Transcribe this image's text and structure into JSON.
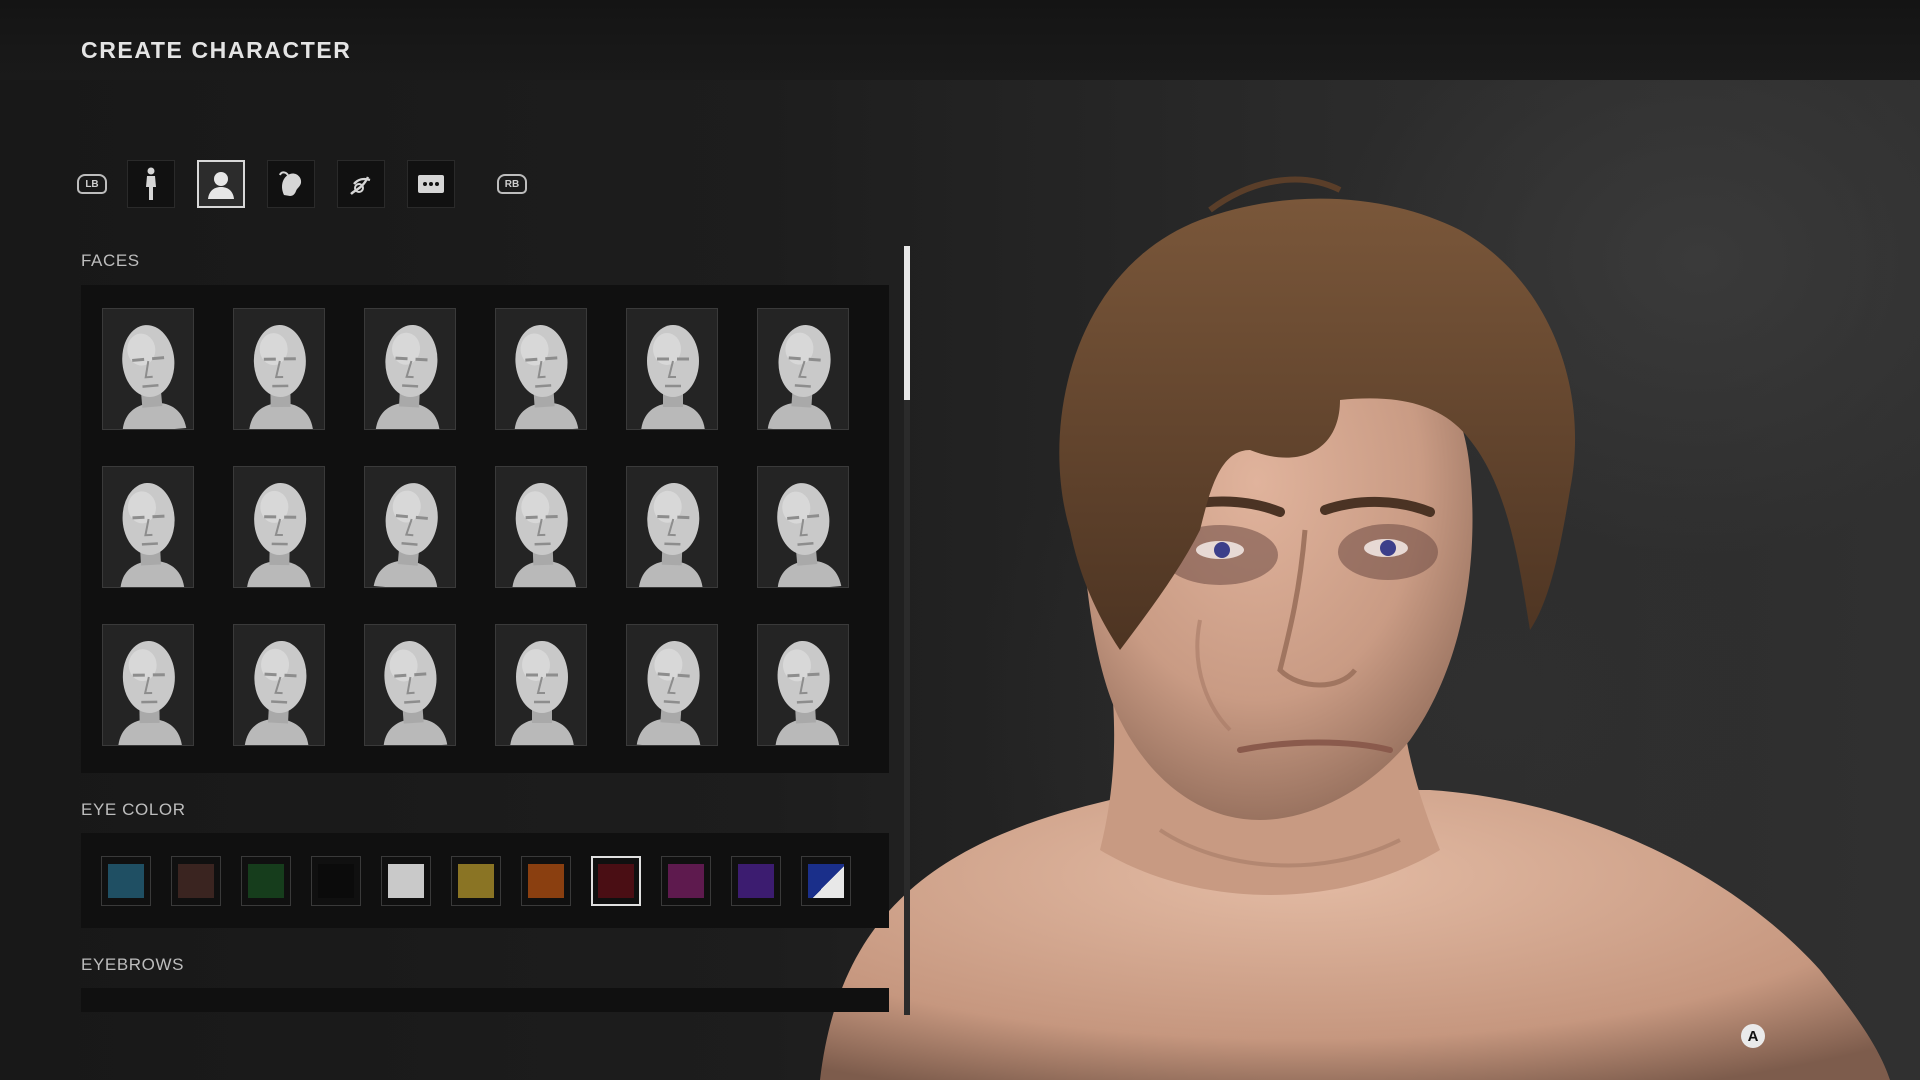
{
  "header": {
    "title": "CREATE CHARACTER"
  },
  "tabs": {
    "left_bumper": "LB",
    "right_bumper": "RB",
    "items": [
      {
        "icon": "body-icon",
        "selected": false
      },
      {
        "icon": "head-icon",
        "selected": true
      },
      {
        "icon": "hair-icon",
        "selected": false
      },
      {
        "icon": "tattoo-icon",
        "selected": false
      },
      {
        "icon": "more-icon",
        "selected": false
      }
    ]
  },
  "faces": {
    "label": "FACES",
    "rows": 3,
    "columns": 6,
    "count": 18
  },
  "eye_color": {
    "label": "EYE COLOR",
    "swatches": [
      {
        "color": "#1f4f63",
        "selected": false
      },
      {
        "color": "#3a2420",
        "selected": false
      },
      {
        "color": "#163d1c",
        "selected": false
      },
      {
        "color": "#0b0b0b",
        "selected": false
      },
      {
        "color": "#c9c9c9",
        "selected": false
      },
      {
        "color": "#8a7424",
        "selected": false
      },
      {
        "color": "#8a3f10",
        "selected": false
      },
      {
        "color": "#4a0e14",
        "selected": true
      },
      {
        "color": "#5e1a4e",
        "selected": false
      },
      {
        "color": "#3c1c70",
        "selected": false
      },
      {
        "color": "#1a2f8a",
        "selected": false,
        "split": true
      }
    ]
  },
  "eyebrows": {
    "label": "EYEBROWS"
  },
  "scrollbar": {
    "position": 0.0,
    "visible_fraction": 0.2
  },
  "prompts": {
    "confirm_button": "A"
  },
  "colors": {
    "panel": "#101010",
    "accent": "#e0e0e0",
    "skin": "#c79a84",
    "hair": "#6b4a30"
  }
}
